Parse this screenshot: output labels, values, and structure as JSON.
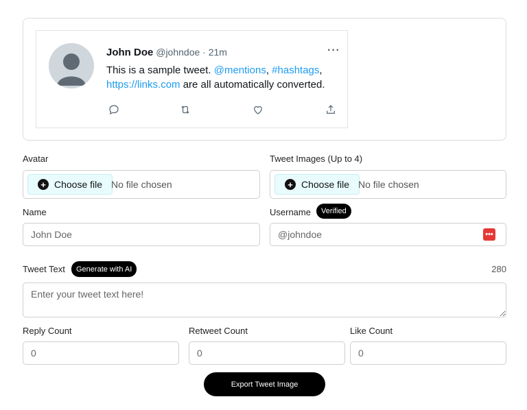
{
  "tweet": {
    "name": "John Doe",
    "handle": "@johndoe",
    "separator": " · ",
    "time": "21m",
    "more": "···",
    "text_1": "This is a sample tweet. ",
    "mentions": "@mentions",
    "comma_1": ", ",
    "hashtags": "#hashtags",
    "comma_2": ",",
    "link": "https://links.com",
    "text_2": " are all automatically converted."
  },
  "form": {
    "avatar_label": "Avatar",
    "images_label": "Tweet Images (Up to 4)",
    "choose_file": "Choose file",
    "no_file": "No file chosen",
    "name_label": "Name",
    "name_placeholder": "John Doe",
    "username_label": "Username",
    "verified": "Verified",
    "username_placeholder": "@johndoe",
    "tweet_text_label": "Tweet Text",
    "generate_ai": "Generate with AI",
    "char_count": "280",
    "tweet_text_placeholder": "Enter your tweet text here!",
    "reply_label": "Reply Count",
    "retweet_label": "Retweet Count",
    "like_label": "Like Count",
    "reply_placeholder": "0",
    "retweet_placeholder": "0",
    "like_placeholder": "0",
    "export": "Export Tweet Image"
  },
  "colors": {
    "link": "#1d9bf0",
    "accent": "#000000",
    "password_icon": "#e53935"
  },
  "icons": [
    "person-icon",
    "more-icon",
    "reply-icon",
    "retweet-icon",
    "like-icon",
    "share-icon",
    "plus-icon",
    "password-manager-icon"
  ]
}
